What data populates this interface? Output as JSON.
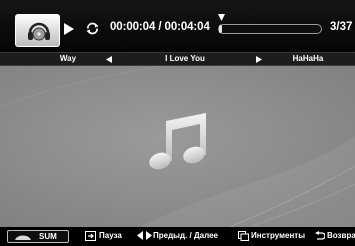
{
  "player": {
    "time_display": "00:00:04 / 00:04:04",
    "progress": 0.016,
    "track_count": "3/37"
  },
  "playlist": {
    "previous_title": "Way",
    "current_title": "I Love You",
    "next_title": "HaHaHa"
  },
  "footer": {
    "sum_label": "SUM",
    "pause_label": "Пауза",
    "prev_next_label": "Предыд. / Далее",
    "tools_label": "Инструменты",
    "return_label": "Возвра"
  },
  "icons": {
    "album_art": "cd-headphones-icon",
    "play": "play-icon",
    "repeat": "repeat-icon",
    "main": "music-note-icon"
  },
  "colors": {
    "background": "#000000",
    "content_area": "#8e8e8e",
    "text": "#ffffff"
  }
}
